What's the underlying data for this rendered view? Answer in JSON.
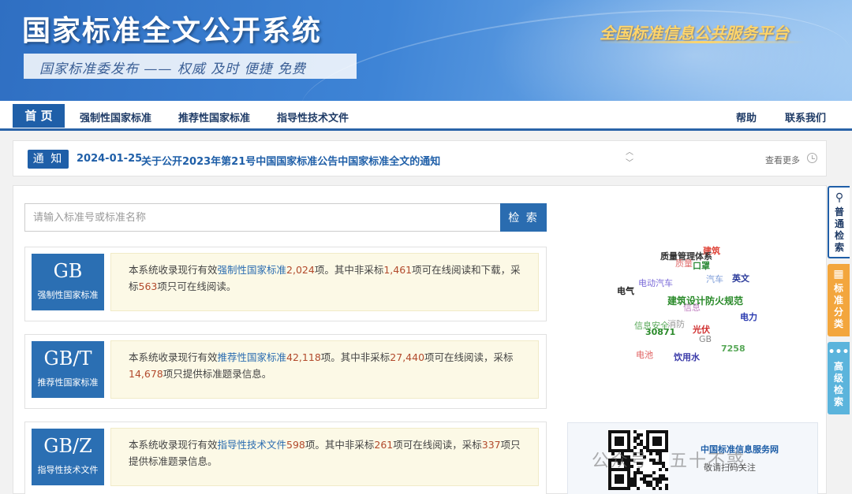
{
  "header": {
    "title": "国家标准全文公开系统",
    "slogan": "国家标准委发布 —— 权威 及时 便捷 免费",
    "platform": "全国标准信息公共服务平台"
  },
  "nav": {
    "home": "首 页",
    "items": [
      "强制性国家标准",
      "推荐性国家标准",
      "指导性技术文件"
    ],
    "help": "帮助",
    "contact": "联系我们"
  },
  "notice": {
    "tag": "通 知",
    "date": "2024-01-25",
    "text": "关于公开2023年第21号中国国家标准公告中国家标准全文的通知",
    "more": "查看更多"
  },
  "search": {
    "placeholder": "请输入标准号或标准名称",
    "button": "检 索"
  },
  "cards": [
    {
      "code": "GB",
      "sub": "强制性国家标准",
      "p1": "本系统收录现行有效",
      "link": "强制性国家标准",
      "total": "2,024",
      "p2": "项。其中非采标",
      "nonadopt": "1,461",
      "p3": "项可在线阅读和下载，采标",
      "adopt": "563",
      "p4": "项只可在线阅读。"
    },
    {
      "code": "GB/T",
      "sub": "推荐性国家标准",
      "p1": "本系统收录现行有效",
      "link": "推荐性国家标准",
      "total": "42,118",
      "p2": "项。其中非采标",
      "nonadopt": "27,440",
      "p3": "项可在线阅读，采标",
      "adopt": "14,678",
      "p4": "项只提供标准题录信息。"
    },
    {
      "code": "GB/Z",
      "sub": "指导性技术文件",
      "p1": "本系统收录现行有效",
      "link": "指导性技术文件",
      "total": "598",
      "p2": "项。其中非采标",
      "nonadopt": "261",
      "p3": "项可在线阅读，采标",
      "adopt": "337",
      "p4": "项只提供标准题录信息。"
    }
  ],
  "cloud": [
    {
      "t": "建筑",
      "c": "#e0473c"
    },
    {
      "t": "质量管理体系",
      "c": "#333333"
    },
    {
      "t": "质量",
      "c": "#e07070"
    },
    {
      "t": "口罩",
      "c": "#2e8b3a"
    },
    {
      "t": "电动汽车",
      "c": "#7a6ad8"
    },
    {
      "t": "汽车",
      "c": "#7a9ad8"
    },
    {
      "t": "英文",
      "c": "#2a3a9a"
    },
    {
      "t": "电气",
      "c": "#222222"
    },
    {
      "t": "建筑设计防火规范",
      "c": "#2a8a2a"
    },
    {
      "t": "信息",
      "c": "#c080c0"
    },
    {
      "t": "信息安全",
      "c": "#58a858"
    },
    {
      "t": "消防",
      "c": "#999999"
    },
    {
      "t": "光伏",
      "c": "#d03030"
    },
    {
      "t": "电力",
      "c": "#2a3ab0"
    },
    {
      "t": "30871",
      "c": "#2a8a2a"
    },
    {
      "t": "GB",
      "c": "#888888"
    },
    {
      "t": "7258",
      "c": "#58a858"
    },
    {
      "t": "电池",
      "c": "#e06060"
    },
    {
      "t": "饮用水",
      "c": "#3a3aa8"
    }
  ],
  "qr": {
    "title": "中国标准信息服务网",
    "sub": "敬请扫码关注",
    "watermark": "公众号 · 五十不惑"
  },
  "side": {
    "s1": "普通检索",
    "s2": "标准分类",
    "s3": "高级检索"
  },
  "colors": {
    "brand": "#1f5fa8",
    "highlight_num": "#b24a2c",
    "desc_bg": "#fcf9e6"
  }
}
